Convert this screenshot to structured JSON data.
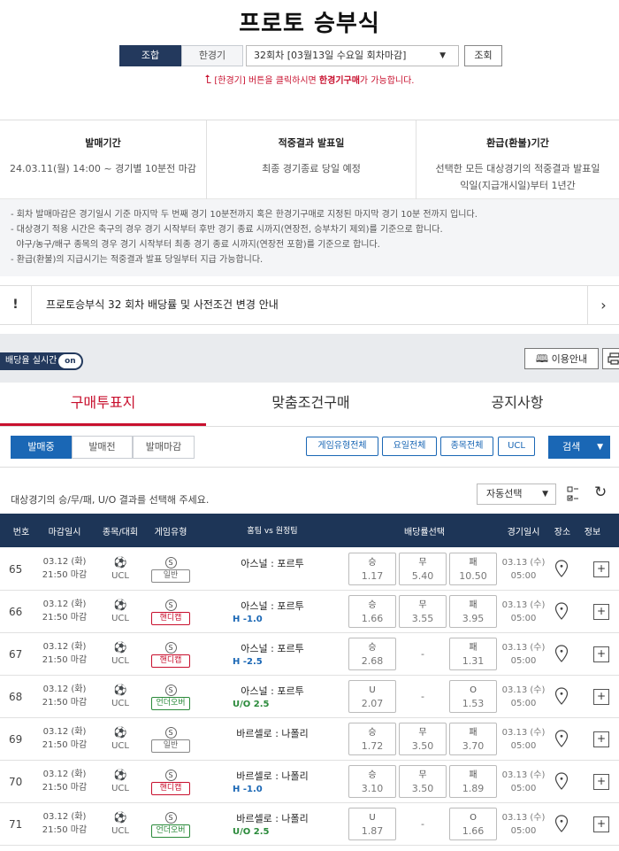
{
  "page": {
    "title": "프로토 승부식"
  },
  "mode": {
    "combo": "조합",
    "single": "한경기"
  },
  "round_select": {
    "value": "32회차 [03월13일 수요일 회차마감]"
  },
  "query_button": "조회",
  "hint": {
    "pre": "[한경기] 버튼을 클릭하시면 ",
    "bold": "한경기구매",
    "post": "가 가능합니다."
  },
  "info": [
    {
      "head": "발매기간",
      "lines": [
        "24.03.11(월) 14:00 ~ 경기별 10분전 마감"
      ]
    },
    {
      "head": "적중결과 발표일",
      "lines": [
        "최종 경기종료 당일 예정"
      ]
    },
    {
      "head": "환급(환불)기간",
      "lines": [
        "선택한 모든 대상경기의 적중결과 발표일",
        "익일(지급개시일)부터 1년간"
      ]
    }
  ],
  "notes": [
    "- 회차 발매마감은 경기일시 기준 마지막 두 번째 경기 10분전까지 혹은 한경기구매로 지정된 마지막 경기 10분 전까지 입니다.",
    "- 대상경기 적용 시간은 축구의 경우 경기 시작부터 후반 경기 종료 시까지(연장전, 승부차기 제외)를 기준으로 합니다.",
    "  야구/농구/배구 종목의 경우 경기 시작부터 최종 경기 종료 시까지(연장전 포함)를 기준으로 합니다.",
    "- 환급(환불)의 지급시기는 적중결과 발표 당일부터 지급 가능합니다."
  ],
  "notice": {
    "text": "프로토승부식 32 회차 배당률 및 사전조건 변경 안내"
  },
  "live": {
    "label": "배당율 실시간",
    "toggle": "on"
  },
  "guide_button": "이용안내",
  "tabs": [
    "구매투표지",
    "맞춤조건구매",
    "공지사항"
  ],
  "sale_tabs": [
    "발매중",
    "발매전",
    "발매마감"
  ],
  "filters": [
    "게임유형전체",
    "요일전체",
    "종목전체",
    "UCL"
  ],
  "search_button": "검색",
  "guideline": "대상경기의 승/무/패, U/O 결과를 선택해 주세요.",
  "auto_select": "자동선택",
  "columns": [
    "번호",
    "마감일시",
    "종목/대회",
    "게임유형",
    "홈팀 vs 원정팀",
    "배당률선택",
    "경기일시",
    "장소",
    "정보"
  ],
  "rows": [
    {
      "no": "65",
      "date": "03.12 (화)",
      "time": "21:50 마감",
      "league": "UCL",
      "sport": "S",
      "type": "일반",
      "tcls": "",
      "home": "아스널",
      "away": "포르투",
      "handi": "",
      "hcls": "",
      "odds": [
        {
          "l": "승",
          "v": "1.17"
        },
        {
          "l": "무",
          "v": "5.40"
        },
        {
          "l": "패",
          "v": "10.50"
        }
      ],
      "mdate": "03.13 (수)",
      "mtime": "05:00"
    },
    {
      "no": "66",
      "date": "03.12 (화)",
      "time": "21:50 마감",
      "league": "UCL",
      "sport": "S",
      "type": "핸디캡",
      "tcls": "red",
      "home": "아스널",
      "away": "포르투",
      "handi": "H -1.0",
      "hcls": "blue",
      "odds": [
        {
          "l": "승",
          "v": "1.66"
        },
        {
          "l": "무",
          "v": "3.55"
        },
        {
          "l": "패",
          "v": "3.95"
        }
      ],
      "mdate": "03.13 (수)",
      "mtime": "05:00"
    },
    {
      "no": "67",
      "date": "03.12 (화)",
      "time": "21:50 마감",
      "league": "UCL",
      "sport": "S",
      "type": "핸디캡",
      "tcls": "red",
      "home": "아스널",
      "away": "포르투",
      "handi": "H -2.5",
      "hcls": "blue",
      "odds": [
        {
          "l": "승",
          "v": "2.68"
        },
        {
          "l": "",
          "v": "-"
        },
        {
          "l": "패",
          "v": "1.31"
        }
      ],
      "mdate": "03.13 (수)",
      "mtime": "05:00"
    },
    {
      "no": "68",
      "date": "03.12 (화)",
      "time": "21:50 마감",
      "league": "UCL",
      "sport": "S",
      "type": "언더오버",
      "tcls": "green",
      "home": "아스널",
      "away": "포르투",
      "handi": "U/O 2.5",
      "hcls": "green",
      "odds": [
        {
          "l": "U",
          "v": "2.07"
        },
        {
          "l": "",
          "v": "-"
        },
        {
          "l": "O",
          "v": "1.53"
        }
      ],
      "mdate": "03.13 (수)",
      "mtime": "05:00"
    },
    {
      "no": "69",
      "date": "03.12 (화)",
      "time": "21:50 마감",
      "league": "UCL",
      "sport": "S",
      "type": "일반",
      "tcls": "",
      "home": "바르셀로",
      "away": "나폴리",
      "handi": "",
      "hcls": "",
      "odds": [
        {
          "l": "승",
          "v": "1.72"
        },
        {
          "l": "무",
          "v": "3.50"
        },
        {
          "l": "패",
          "v": "3.70"
        }
      ],
      "mdate": "03.13 (수)",
      "mtime": "05:00"
    },
    {
      "no": "70",
      "date": "03.12 (화)",
      "time": "21:50 마감",
      "league": "UCL",
      "sport": "S",
      "type": "핸디캡",
      "tcls": "red",
      "home": "바르셀로",
      "away": "나폴리",
      "handi": "H -1.0",
      "hcls": "blue",
      "odds": [
        {
          "l": "승",
          "v": "3.10"
        },
        {
          "l": "무",
          "v": "3.50"
        },
        {
          "l": "패",
          "v": "1.89"
        }
      ],
      "mdate": "03.13 (수)",
      "mtime": "05:00"
    },
    {
      "no": "71",
      "date": "03.12 (화)",
      "time": "21:50 마감",
      "league": "UCL",
      "sport": "S",
      "type": "언더오버",
      "tcls": "green",
      "home": "바르셀로",
      "away": "나폴리",
      "handi": "U/O 2.5",
      "hcls": "green",
      "odds": [
        {
          "l": "U",
          "v": "1.87"
        },
        {
          "l": "",
          "v": "-"
        },
        {
          "l": "O",
          "v": "1.66"
        }
      ],
      "mdate": "03.13 (수)",
      "mtime": "05:00"
    }
  ]
}
